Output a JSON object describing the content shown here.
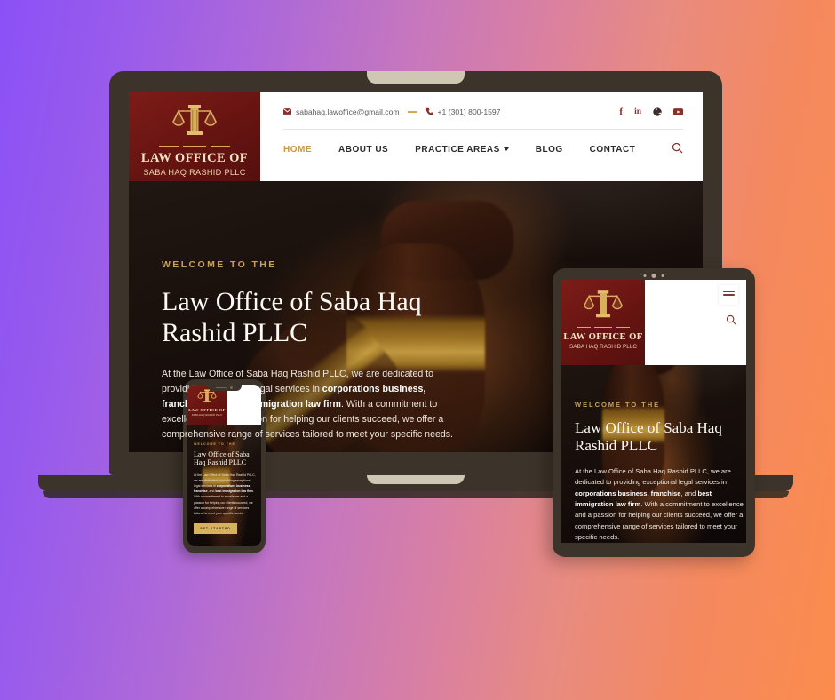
{
  "background": {
    "gradient_from": "#8b51f6",
    "gradient_to": "#fb8c4d"
  },
  "theme": {
    "brand_maroon": "#6b1512",
    "gold": "#d6b15e",
    "accent_gold_text": "#c9a159",
    "frame": "#3c332a"
  },
  "site": {
    "logo": {
      "icon": "scales-of-justice-icon",
      "line1": "LAW OFFICE OF",
      "line2": "SABA HAQ RASHID PLLC"
    },
    "topbar": {
      "email_icon": "envelope-icon",
      "email": "sabahaq.lawoffice@gmail.com",
      "separator": "—",
      "phone_icon": "phone-icon",
      "phone": "+1 (301) 800-1597",
      "socials": [
        {
          "name": "facebook-icon",
          "glyph": "f"
        },
        {
          "name": "linkedin-icon",
          "glyph": "in"
        },
        {
          "name": "whatsapp-icon",
          "glyph": "●"
        },
        {
          "name": "youtube-icon",
          "glyph": "▶"
        }
      ]
    },
    "nav": {
      "items": [
        {
          "label": "HOME",
          "active": true,
          "dropdown": false
        },
        {
          "label": "ABOUT US",
          "active": false,
          "dropdown": false
        },
        {
          "label": "PRACTICE AREAS",
          "active": false,
          "dropdown": true
        },
        {
          "label": "BLOG",
          "active": false,
          "dropdown": false
        },
        {
          "label": "CONTACT",
          "active": false,
          "dropdown": false
        }
      ],
      "search_icon": "search-icon",
      "menu_icon": "hamburger-menu-icon"
    },
    "hero": {
      "eyebrow": "WELCOME TO THE",
      "heading": "Law Office of Saba Haq Rashid PLLC",
      "paragraph_parts": [
        {
          "t": "At the Law Office of Saba Haq Rashid PLLC, we are dedicated to providing exceptional legal services in ",
          "b": false
        },
        {
          "t": "corporations business, franchise",
          "b": true
        },
        {
          "t": ", and ",
          "b": false
        },
        {
          "t": "best immigration law firm",
          "b": true
        },
        {
          "t": ". With a commitment to excellence and a passion for helping our clients succeed, we offer a comprehensive range of services tailored to meet your specific needs.",
          "b": false
        }
      ],
      "cta_label": "GET STARTED"
    }
  },
  "devices": {
    "laptop": {
      "name": "laptop-mockup"
    },
    "tablet": {
      "name": "tablet-mockup"
    },
    "phone": {
      "name": "phone-mockup"
    }
  }
}
